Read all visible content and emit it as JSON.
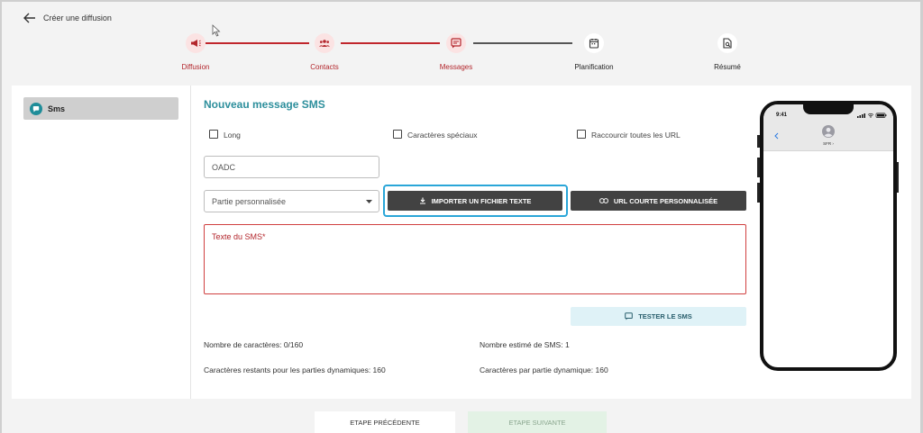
{
  "header": {
    "title": "Créer une diffusion"
  },
  "stepper": {
    "steps": [
      {
        "label": "Diffusion",
        "icon": "megaphone-icon",
        "state": "done"
      },
      {
        "label": "Contacts",
        "icon": "group-icon",
        "state": "done"
      },
      {
        "label": "Messages",
        "icon": "message-icon",
        "state": "active"
      },
      {
        "label": "Planification",
        "icon": "calendar-icon",
        "state": "todo"
      },
      {
        "label": "Résumé",
        "icon": "document-search-icon",
        "state": "todo"
      }
    ]
  },
  "sidebar": {
    "items": [
      {
        "label": "Sms",
        "icon": "sms-icon"
      }
    ]
  },
  "form": {
    "title": "Nouveau message SMS",
    "checkboxes": {
      "long": "Long",
      "special": "Caractères spéciaux",
      "shorten": "Raccourcir toutes les URL"
    },
    "oadc_value": "OADC",
    "select_value": "Partie personnalisée",
    "import_button": "IMPORTER UN FICHIER TEXTE",
    "url_button": "URL COURTE PERSONNALISÉE",
    "textarea_label": "Texte du SMS*",
    "test_button": "TESTER LE SMS",
    "stats": {
      "char_count": "Nombre de caractères: 0/160",
      "sms_count": "Nombre estimé de SMS: 1",
      "remaining": "Caractères restants pour les parties dynamiques: 160",
      "per_part": "Caractères par partie dynamique: 160"
    }
  },
  "phone": {
    "time": "9:41",
    "sender": "SFR ›"
  },
  "footer": {
    "prev": "ETAPE PRÉCÉDENTE",
    "next": "ETAPE SUIVANTE"
  },
  "colors": {
    "accent_red": "#b3262c",
    "teal": "#2d8f9c",
    "highlight": "#2aa6d8",
    "dark_button": "#424242"
  }
}
